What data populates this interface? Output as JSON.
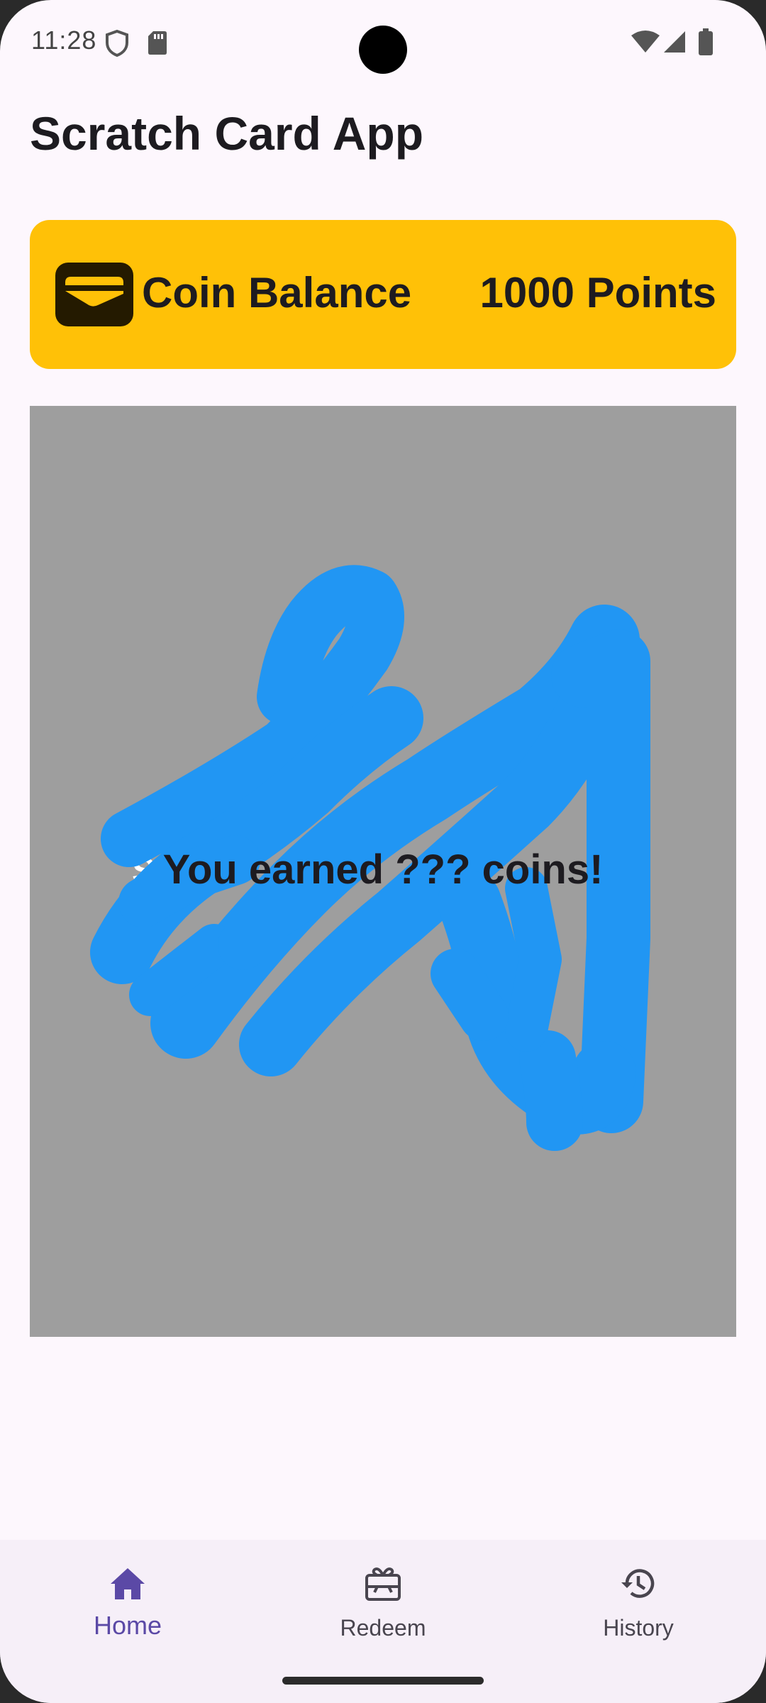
{
  "status_bar": {
    "time": "11:28",
    "icons": [
      "shield-icon",
      "sd-card-icon",
      "wifi-icon",
      "signal-icon",
      "battery-icon"
    ]
  },
  "app": {
    "title": "Scratch Card App"
  },
  "balance": {
    "label": "Coin Balance",
    "value": "1000 Points",
    "icon": "wallet-icon",
    "color": "#ffc107"
  },
  "scratch_card": {
    "reward_text": "You earned ??? coins!",
    "hidden_text_fragment": "Sc",
    "cover_color": "#9e9e9e",
    "scratch_color": "#2196f3"
  },
  "bottom_nav": {
    "items": [
      {
        "label": "Home",
        "icon": "home-icon",
        "selected": true
      },
      {
        "label": "Redeem",
        "icon": "gift-card-icon",
        "selected": false
      },
      {
        "label": "History",
        "icon": "history-icon",
        "selected": false
      }
    ],
    "selected_color": "#5b49a6"
  }
}
